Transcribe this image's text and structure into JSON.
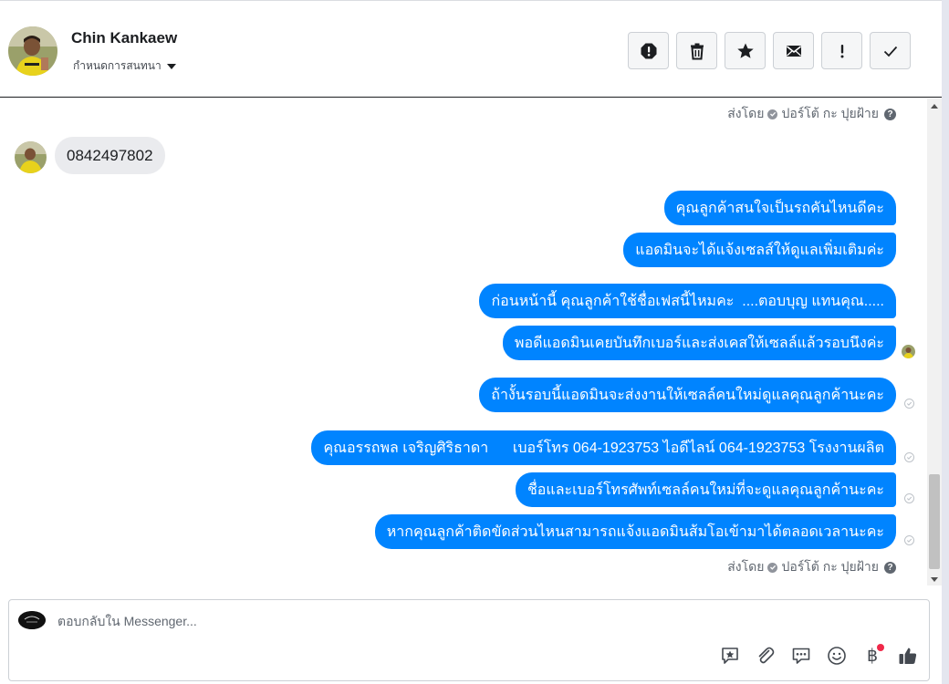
{
  "header": {
    "contact_name": "Chin Kankaew",
    "assign_label": "กำหนดการสนทนา",
    "actions": [
      {
        "name": "spam-button",
        "icon": "alert-octagon-icon"
      },
      {
        "name": "delete-button",
        "icon": "trash-icon"
      },
      {
        "name": "star-button",
        "icon": "star-icon"
      },
      {
        "name": "mark-unread-button",
        "icon": "envelope-icon"
      },
      {
        "name": "follow-up-button",
        "icon": "exclamation-icon"
      },
      {
        "name": "mark-done-button",
        "icon": "check-icon"
      }
    ]
  },
  "conversation": {
    "sent_by_label": "ส่งโดย",
    "sent_by_name": "ปอร์โต้ กะ ปุยฝ้าย",
    "help_glyph": "?",
    "incoming_message": "0842497802",
    "outgoing_messages": [
      "คุณลูกค้าสนใจเป็นรถคันไหนดีคะ",
      "แอดมินจะได้แจ้งเซลส์ให้ดูแลเพิ่มเติมค่ะ",
      "ก่อนหน้านี้ คุณลูกค้าใช้ชื่อเฟสนี้ไหมคะ  ....ตอบบุญ แทนคุณ.....",
      "พอดีแอดมินเคยบันทึกเบอร์และส่งเคสให้เซลล์แล้วรอบนึงค่ะ",
      "ถ้างั้นรอบนี้แอดมินจะส่งงานให้เซลล์คนใหม่ดูแลคุณลูกค้านะคะ",
      "คุณอรรถพล เจริญศิริธาดา      เบอร์โทร 064-1923753 ไอดีไลน์ 064-1923753 โรงงานผลิต",
      "ชื่อและเบอร์โทรศัพท์เซลล์คนใหม่ที่จะดูแลคุณลูกค้านะคะ",
      "หากคุณลูกค้าติดขัดส่วนไหนสามารถแจ้งแอดมินส้มโอเข้ามาได้ตลอดเวลานะคะ"
    ]
  },
  "composer": {
    "placeholder": "ตอบกลับใน Messenger...",
    "value": "",
    "tools": [
      "saved-replies-icon",
      "attachment-icon",
      "chat-bubble-icon",
      "emoji-icon",
      "baht-payment-icon",
      "like-icon"
    ],
    "baht_glyph": "฿"
  },
  "colors": {
    "bubble_outgoing": "#0084ff",
    "bubble_incoming": "#eaebee",
    "notification_dot": "#f02849"
  }
}
